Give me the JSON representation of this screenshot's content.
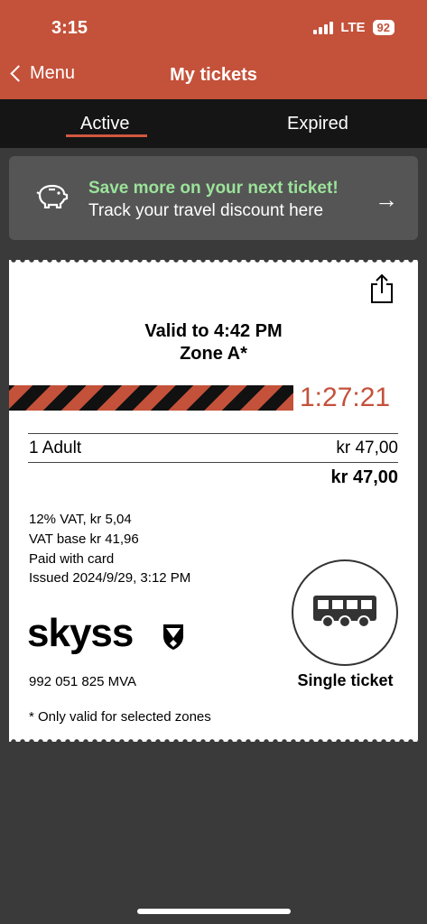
{
  "status": {
    "time": "3:15",
    "network": "LTE",
    "battery": "92"
  },
  "nav": {
    "back_label": "Menu",
    "title": "My tickets"
  },
  "tabs": [
    {
      "label": "Active"
    },
    {
      "label": "Expired"
    }
  ],
  "promo": {
    "title": "Save more on your next ticket!",
    "subtitle": "Track your travel discount here",
    "arrow": "→"
  },
  "ticket": {
    "valid_to": "Valid to 4:42 PM",
    "zone": "Zone A*",
    "timer": "1:27:21",
    "passenger": "1  Adult",
    "price": "kr 47,00",
    "total": "kr 47,00",
    "vat": "12% VAT, kr 5,04",
    "vat_base": "VAT base kr 41,96",
    "payment": "Paid with card",
    "issued": "Issued 2024/9/29, 3:12 PM",
    "brand": "skyss",
    "org_number": "992 051 825 MVA",
    "footnote": "* Only valid for selected zones",
    "type_label": "Single ticket"
  },
  "colors": {
    "brand": "#c4513a",
    "promo_title": "#9be39a",
    "background": "#3a3a3a"
  },
  "icons": [
    "chevron-left-icon",
    "piggy-bank-icon",
    "arrow-right-icon",
    "share-icon",
    "bus-icon",
    "shield-logo-icon"
  ]
}
